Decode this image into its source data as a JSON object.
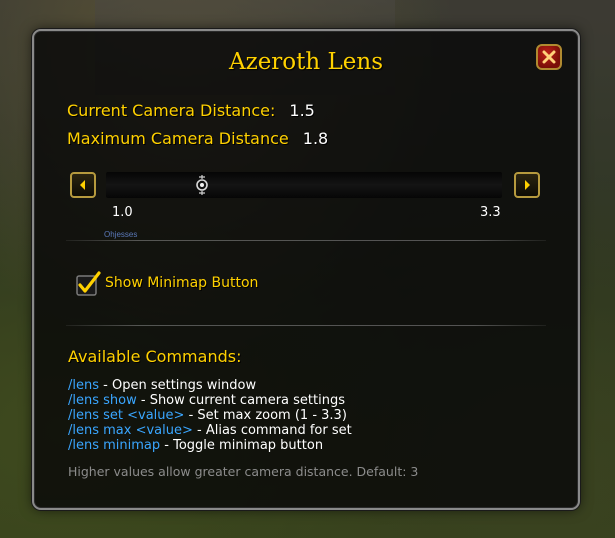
{
  "window": {
    "title": "Azeroth Lens"
  },
  "camera": {
    "current_label": "Current Camera Distance:",
    "current_value": "1.5",
    "max_label": "Maximum Camera Distance",
    "max_value": "1.8"
  },
  "slider": {
    "min_label": "1.0",
    "max_label": "3.3",
    "min": 1.0,
    "max": 3.3,
    "value": 1.8,
    "sub_label": "Ohjesses"
  },
  "options": {
    "minimap_label": "Show Minimap Button",
    "minimap_checked": true
  },
  "commands": {
    "heading": "Available Commands:",
    "items": [
      {
        "cmd": "/lens",
        "desc": " - Open settings window"
      },
      {
        "cmd": "/lens show",
        "desc": " - Show current camera settings"
      },
      {
        "cmd": "/lens set <value>",
        "desc": " - Set max zoom (1 - 3.3)"
      },
      {
        "cmd": "/lens max <value>",
        "desc": " - Alias command for set"
      },
      {
        "cmd": "/lens minimap",
        "desc": " - Toggle minimap button"
      }
    ]
  },
  "footnote": "Higher values allow greater camera distance. Default: 3",
  "colors": {
    "accent_gold": "#ffd100",
    "command_blue": "#3aa6ff",
    "muted_gray": "#8c8c8c"
  },
  "icons": {
    "close": "close-x-icon",
    "left": "arrow-left-icon",
    "right": "arrow-right-icon",
    "thumb": "slider-thumb-icon",
    "check": "checkmark-icon"
  }
}
